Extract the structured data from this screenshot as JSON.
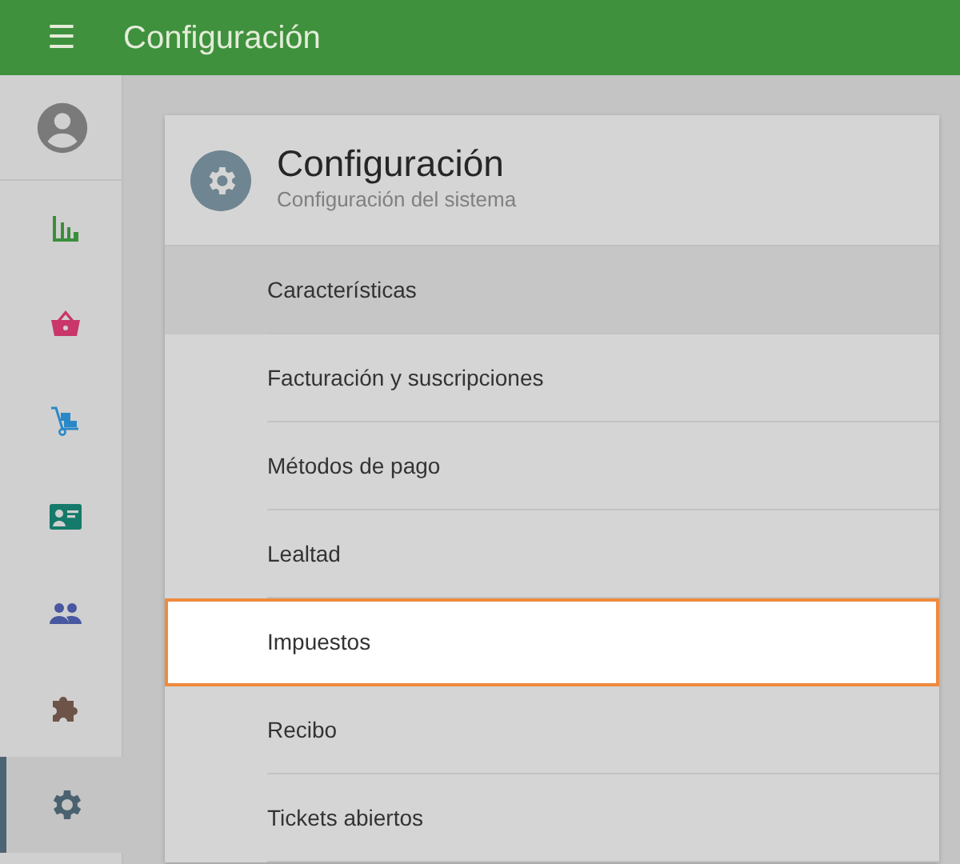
{
  "top_bar": {
    "menu_icon": "☰",
    "title": "Configuración"
  },
  "sidebar": {
    "items": [
      {
        "kind": "account",
        "color": "#7a7a7a",
        "selected": false
      },
      {
        "kind": "chart",
        "color": "#3b8e3b",
        "selected": false
      },
      {
        "kind": "basket",
        "color": "#c8366a",
        "selected": false
      },
      {
        "kind": "trolley",
        "color": "#2a88c8",
        "selected": false
      },
      {
        "kind": "id-card",
        "color": "#157a6a",
        "selected": false
      },
      {
        "kind": "people",
        "color": "#4757a0",
        "selected": false
      },
      {
        "kind": "puzzle",
        "color": "#6e5448",
        "selected": false
      },
      {
        "kind": "gear",
        "color": "#4a6270",
        "selected": true
      }
    ]
  },
  "card": {
    "title": "Configuración",
    "subtitle": "Configuración del sistema",
    "items": [
      {
        "label": "Características",
        "selected": true,
        "highlighted": false
      },
      {
        "label": "Facturación y suscripciones",
        "selected": false,
        "highlighted": false
      },
      {
        "label": "Métodos de pago",
        "selected": false,
        "highlighted": false
      },
      {
        "label": "Lealtad",
        "selected": false,
        "highlighted": false
      },
      {
        "label": "Impuestos",
        "selected": false,
        "highlighted": true
      },
      {
        "label": "Recibo",
        "selected": false,
        "highlighted": false
      },
      {
        "label": "Tickets abiertos",
        "selected": false,
        "highlighted": false
      }
    ]
  }
}
